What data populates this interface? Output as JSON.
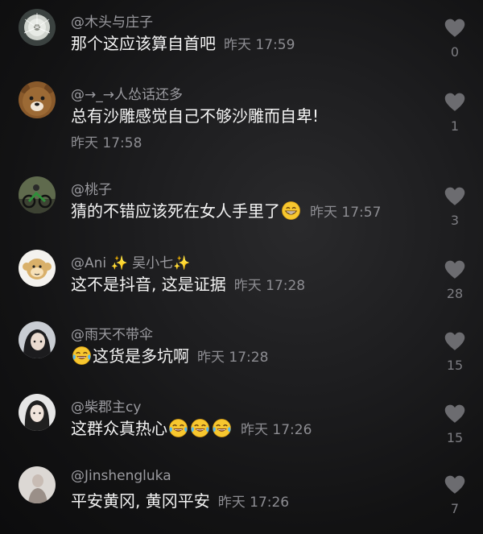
{
  "comments": [
    {
      "username": "@木头与庄子",
      "text": "那个这应该算自首吧",
      "time": "昨天 17:59",
      "likes": "0"
    },
    {
      "username": "@→_→人怂话还多",
      "text": "总有沙雕感觉自己不够沙雕而自卑!",
      "time": "昨天 17:58",
      "likes": "1"
    },
    {
      "username": "@桃子",
      "text": "猜的不错应该死在女人手里了",
      "time": "昨天 17:57",
      "likes": "3"
    },
    {
      "username_prefix": "@Ani ",
      "username_star1": "✨",
      "username_mid": " 吴小七",
      "username_star2": "✨",
      "text": "这不是抖音, 这是证据",
      "time": "昨天 17:28",
      "likes": "28"
    },
    {
      "username": "@雨天不带伞",
      "text": "这货是多坑啊",
      "time": "昨天 17:28",
      "likes": "15"
    },
    {
      "username": "@柴郡主cy",
      "text": "这群众真热心",
      "time": "昨天 17:26",
      "likes": "15"
    },
    {
      "username": "@Jinshengluka",
      "text": "平安黄冈, 黄冈平安",
      "time": "昨天 17:26",
      "likes": "7"
    }
  ],
  "icons": {
    "like": "heart-icon",
    "grin_emoji": "grinning-face-emoji",
    "laugh_emoji": "laughing-tears-emoji"
  },
  "colors": {
    "background": "#1a1a1c",
    "username": "#9b9ba0",
    "comment_text": "#f4f4f4",
    "timestamp": "#8d8d92",
    "like_icon": "#6c6c70"
  }
}
